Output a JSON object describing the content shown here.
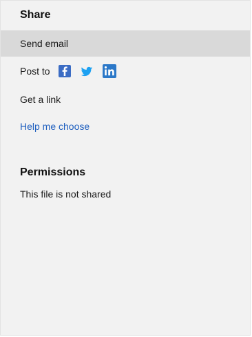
{
  "share": {
    "title": "Share",
    "items": [
      {
        "label": "Send email",
        "selected": true
      },
      {
        "label": "Post to"
      },
      {
        "label": "Get a link"
      }
    ],
    "help_link": "Help me choose",
    "social_icons": [
      "facebook-icon",
      "twitter-icon",
      "linkedin-icon"
    ]
  },
  "permissions": {
    "title": "Permissions",
    "status": "This file is not shared"
  },
  "colors": {
    "panel_bg": "#f2f2f2",
    "selected_bg": "#d9d9d9",
    "link": "#1f5fbf",
    "facebook": "#3b6cc4",
    "twitter": "#1da1f2",
    "linkedin": "#2b78c8"
  }
}
